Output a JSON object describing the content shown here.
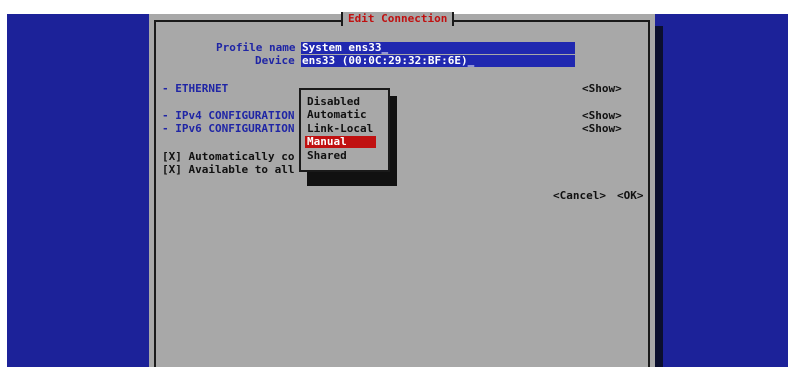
{
  "window": {
    "title": "Edit Connection"
  },
  "profile": {
    "label": "Profile name",
    "value": "System ens33_"
  },
  "device": {
    "label": "Device",
    "value": "ens33 (00:0C:29:32:BF:6E)_"
  },
  "sections": {
    "ethernet": {
      "label": "- ETHERNET",
      "action": "<Show>"
    },
    "ipv4": {
      "label": "- IPv4 CONFIGURATION",
      "action": "<Show>"
    },
    "ipv6": {
      "label": "- IPv6 CONFIGURATION",
      "action": "<Show>"
    }
  },
  "checkboxes": {
    "auto_connect": "[X] Automatically co",
    "available": "[X] Available to all"
  },
  "dropdown": {
    "options": [
      "Disabled",
      "Automatic",
      "Link-Local",
      "Manual",
      "Shared"
    ],
    "selected": "Manual"
  },
  "buttons": {
    "cancel": "<Cancel>",
    "ok": "<OK>"
  },
  "colors": {
    "background": "#1c2299",
    "window": "#a8a8a8",
    "accent": "#c01010",
    "field": "#2028b0"
  }
}
